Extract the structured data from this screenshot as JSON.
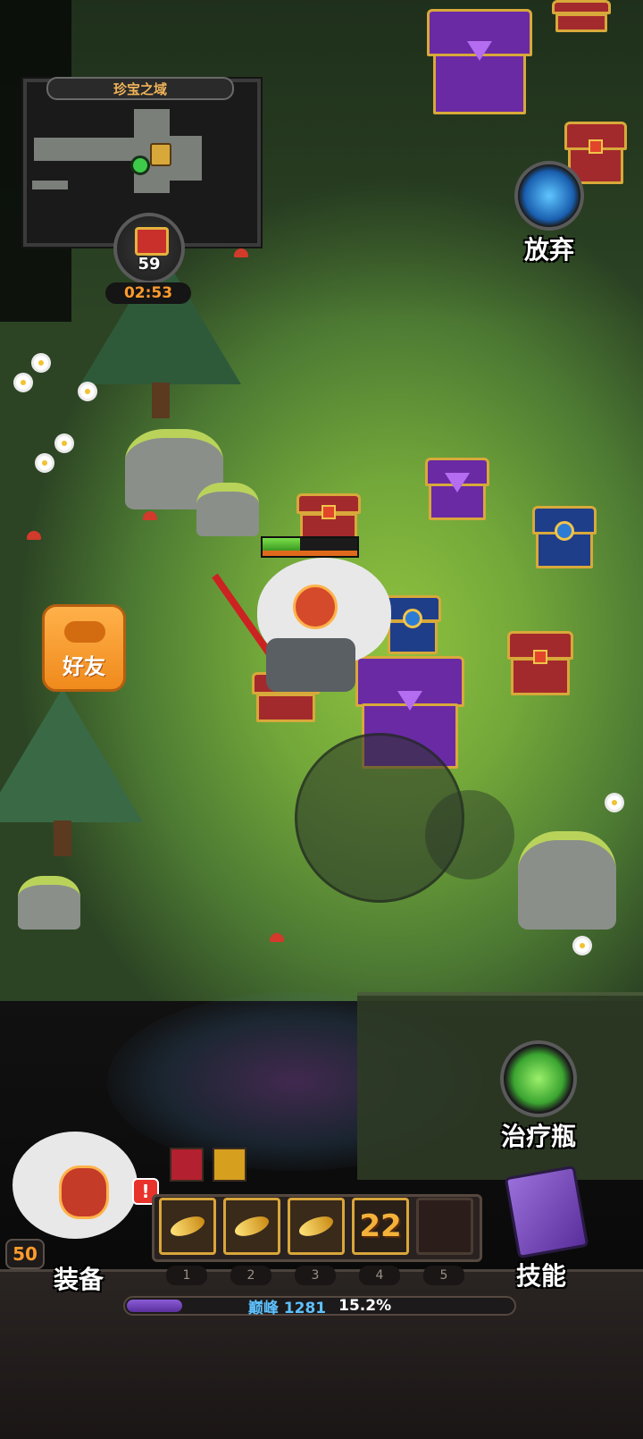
{
  "minimap": {
    "title": "珍宝之域"
  },
  "boss_badge": {
    "count": "59",
    "timer": "02:53"
  },
  "buttons": {
    "abandon": {
      "label": "放弃",
      "icon": "portal-icon"
    },
    "friend": {
      "label": "好友",
      "icon": "cloud-icon"
    },
    "potion": {
      "label": "治疗瓶",
      "icon": "potion-icon"
    },
    "equip": {
      "label": "装备",
      "alert": "!"
    },
    "skills": {
      "label": "技能",
      "icon": "spellbook-icon"
    }
  },
  "hero": {
    "level": "50",
    "hp_fraction": 0.4
  },
  "buffs": [
    {
      "icon": "rage-buff-icon"
    },
    {
      "icon": "slash-buff-icon"
    }
  ],
  "skill_slots": [
    {
      "number": "1",
      "icon": "wind-slash-icon"
    },
    {
      "number": "2",
      "icon": "blade-wave-icon"
    },
    {
      "number": "3",
      "icon": "claw-icon"
    },
    {
      "number": "4",
      "value": "22"
    },
    {
      "number": "5"
    }
  ],
  "experience": {
    "tier": "巅峰",
    "value": "1281",
    "percent": "15.2%",
    "fraction": 0.152
  },
  "colors": {
    "accent_orange": "#ff9b2d",
    "xp_blue": "#5ec1ff",
    "xp_purple": "#8b5cd6"
  }
}
